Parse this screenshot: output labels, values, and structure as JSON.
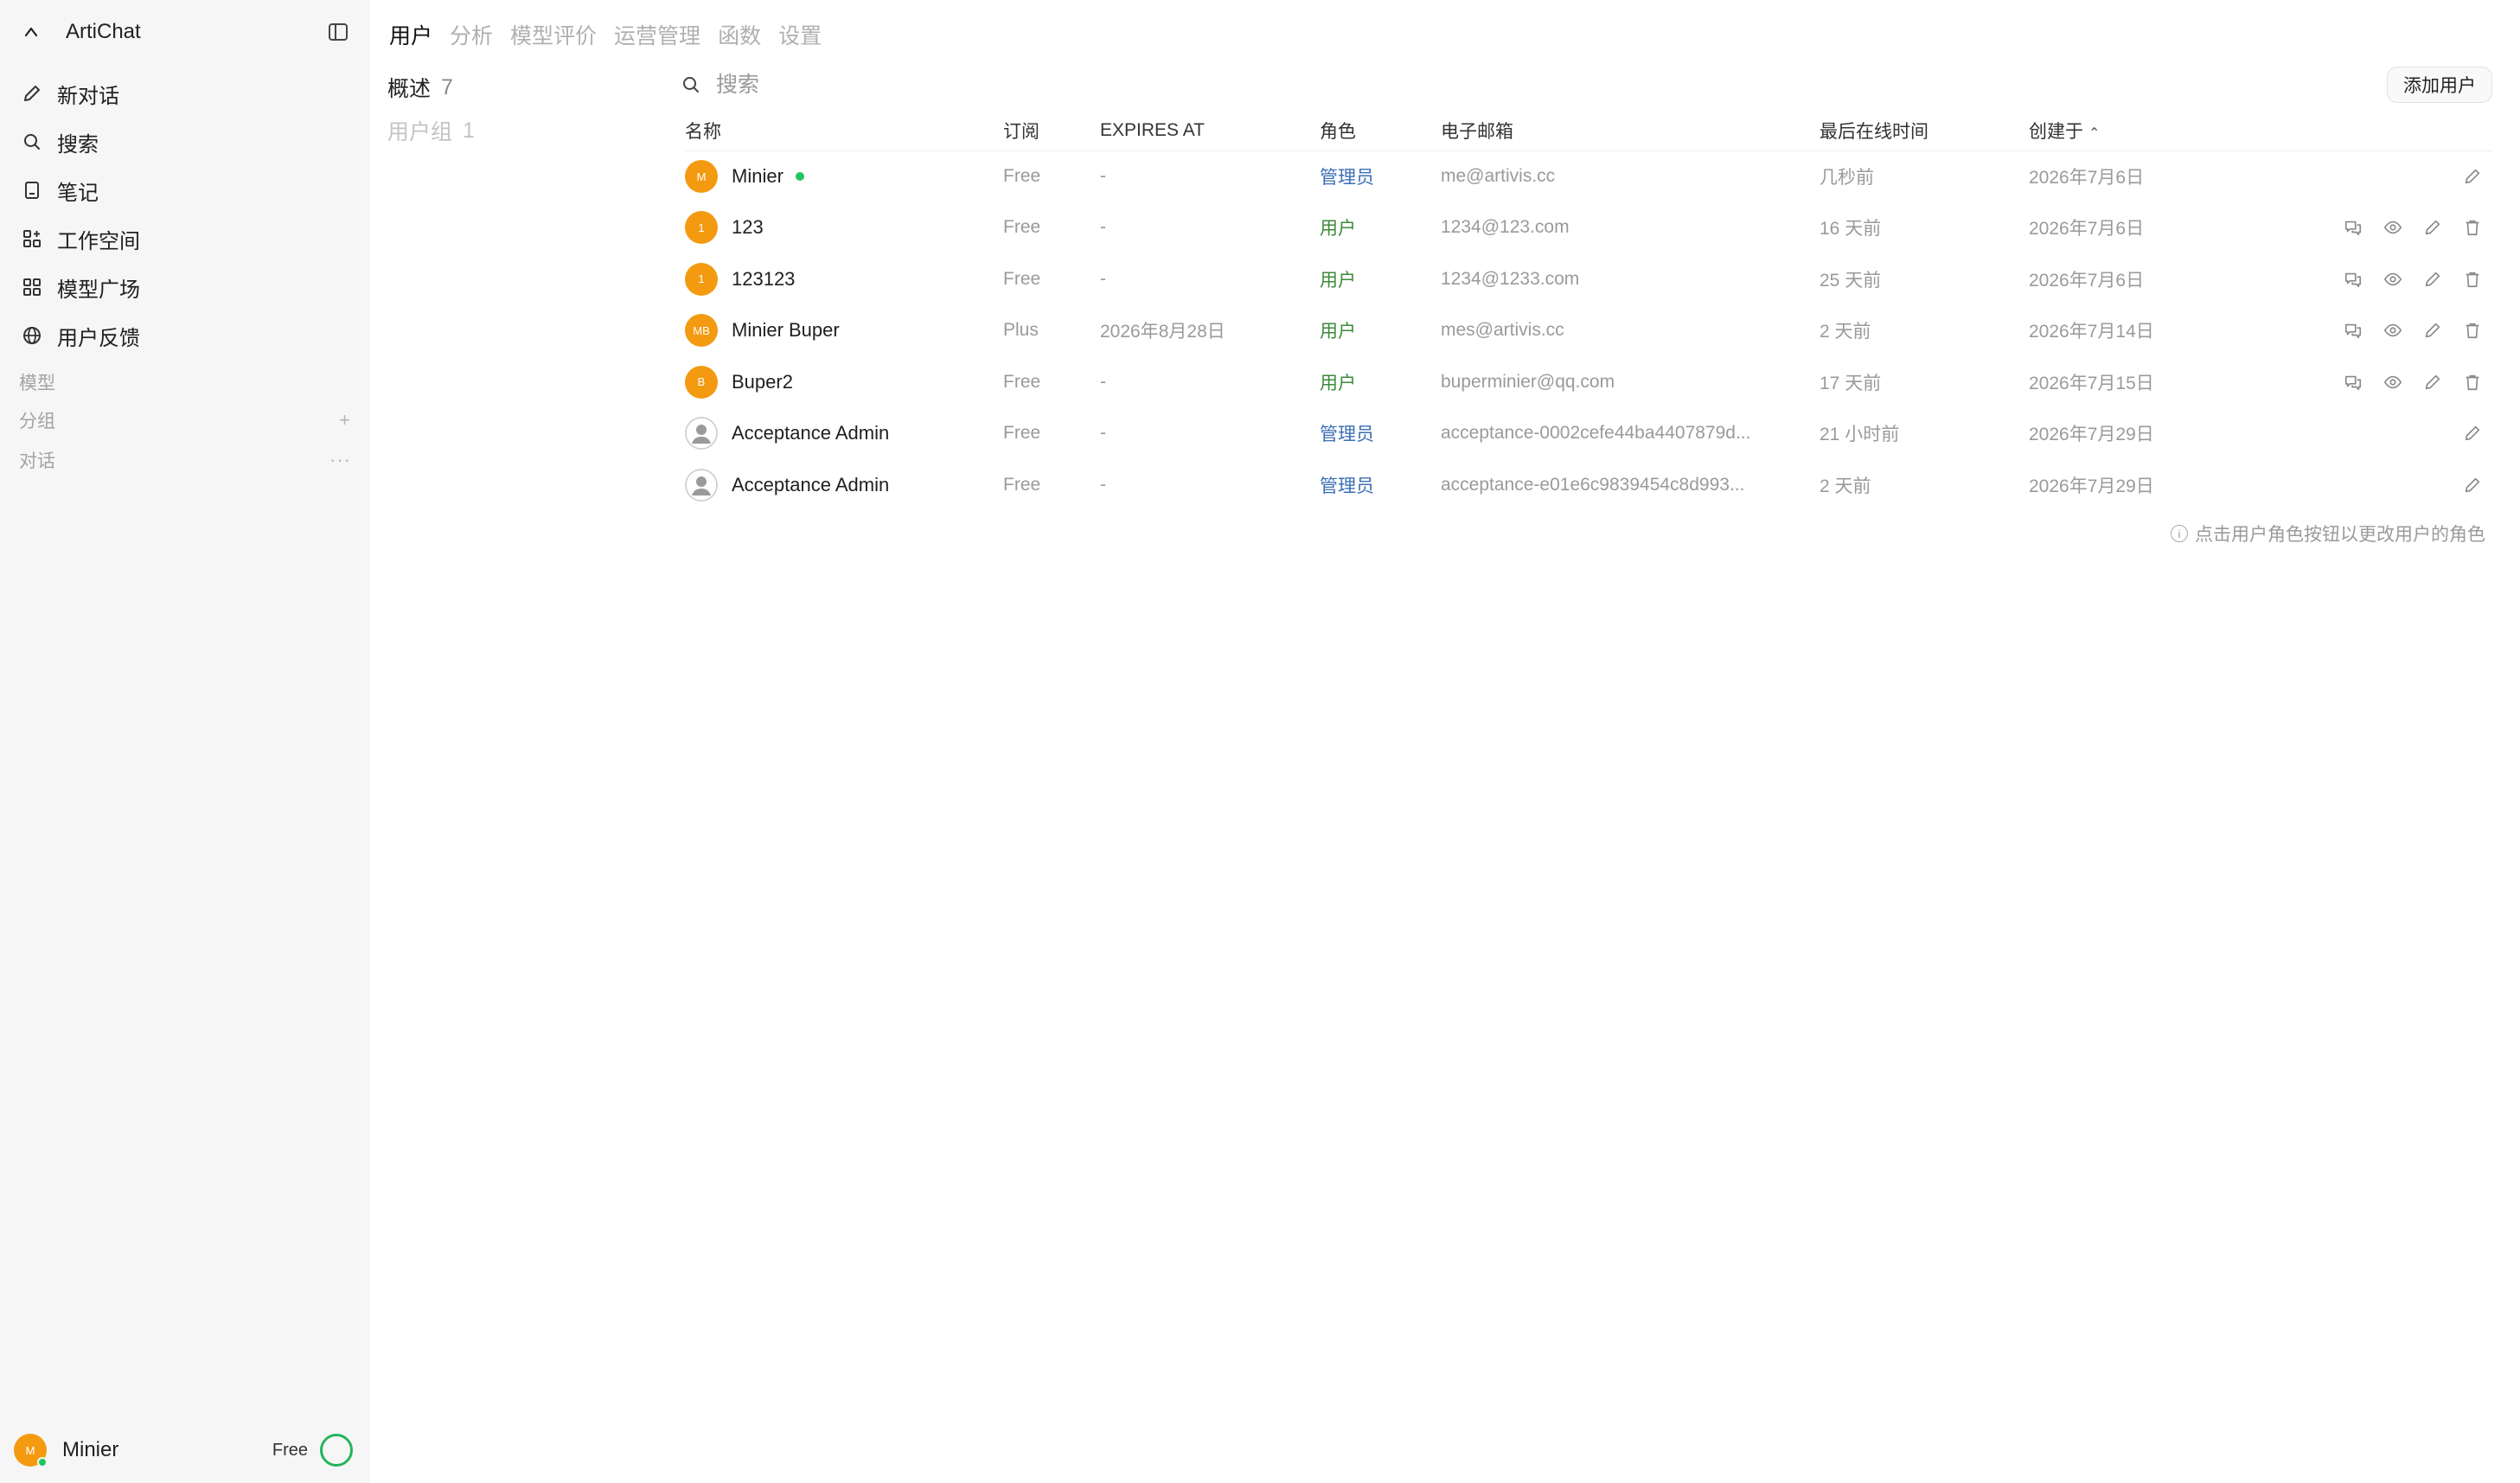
{
  "app": {
    "title": "ArtiChat"
  },
  "sidebar": {
    "items": [
      {
        "label": "新对话",
        "icon": "pencil-icon"
      },
      {
        "label": "搜索",
        "icon": "search-icon"
      },
      {
        "label": "笔记",
        "icon": "notebook-icon"
      },
      {
        "label": "工作空间",
        "icon": "workspace-icon"
      },
      {
        "label": "模型广场",
        "icon": "grid-icon"
      },
      {
        "label": "用户反馈",
        "icon": "globe-icon"
      }
    ],
    "sections": {
      "models": "模型",
      "groups": "分组",
      "chats": "对话",
      "groups_action": "+",
      "chats_action": "···"
    },
    "user": {
      "name": "Minier",
      "plan": "Free",
      "avatar": "M"
    }
  },
  "tabs": [
    "用户",
    "分析",
    "模型评价",
    "运营管理",
    "函数",
    "设置"
  ],
  "subnav": {
    "overview": {
      "label": "概述",
      "count": "7"
    },
    "groups": {
      "label": "用户组",
      "count": "1"
    }
  },
  "search": {
    "placeholder": "搜索"
  },
  "add_user_label": "添加用户",
  "table": {
    "columns": {
      "name": "名称",
      "subscription": "订阅",
      "expires": "EXPIRES AT",
      "role": "角色",
      "email": "电子邮箱",
      "last_active": "最后在线时间",
      "created": "创建于"
    },
    "sort_indicator": "⌃",
    "rows": [
      {
        "avatar": "M",
        "name": "Minier",
        "online": true,
        "subscription": "Free",
        "expires": "-",
        "role": "管理员",
        "email": "me@artivis.cc",
        "last_active": "几秒前",
        "created": "2026年7月6日"
      },
      {
        "avatar": "1",
        "name": "123",
        "subscription": "Free",
        "expires": "-",
        "role": "用户",
        "email": "1234@123.com",
        "last_active": "16 天前",
        "created": "2026年7月6日"
      },
      {
        "avatar": "1",
        "name": "123123",
        "subscription": "Free",
        "expires": "-",
        "role": "用户",
        "email": "1234@1233.com",
        "last_active": "25 天前",
        "created": "2026年7月6日"
      },
      {
        "avatar": "MB",
        "name": "Minier Buper",
        "subscription": "Plus",
        "expires": "2026年8月28日",
        "role": "用户",
        "email": "mes@artivis.cc",
        "last_active": "2 天前",
        "created": "2026年7月14日"
      },
      {
        "avatar": "B",
        "name": "Buper2",
        "subscription": "Free",
        "expires": "-",
        "role": "用户",
        "email": "buperminier@qq.com",
        "last_active": "17 天前",
        "created": "2026年7月15日"
      },
      {
        "avatar": "",
        "name": "Acceptance Admin",
        "subscription": "Free",
        "expires": "-",
        "role": "管理员",
        "email": "acceptance-0002cefe44ba4407879d...",
        "last_active": "21 小时前",
        "created": "2026年7月29日"
      },
      {
        "avatar": "",
        "name": "Acceptance Admin",
        "subscription": "Free",
        "expires": "-",
        "role": "管理员",
        "email": "acceptance-e01e6c9839454c8d993...",
        "last_active": "2 天前",
        "created": "2026年7月29日"
      }
    ]
  },
  "hint": {
    "icon": "ⓘ",
    "text": "点击用户角色按钮以更改用户的角色"
  },
  "colors": {
    "accent_avatar": "#f39a11",
    "online": "#22c55e",
    "admin_role": "#3b6fb5",
    "user_role": "#3c8a3a"
  }
}
